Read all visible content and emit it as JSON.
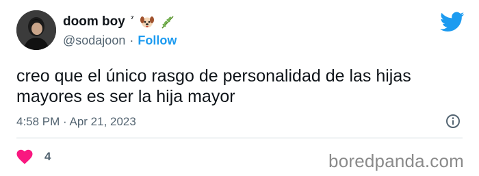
{
  "user": {
    "display_name": "doom boy",
    "superscript": "⁷",
    "emoji_icons": [
      "dog-face-icon",
      "herb-icon"
    ],
    "handle": "@sodajoon",
    "separator": "·",
    "follow_label": "Follow"
  },
  "tweet": {
    "text": "creo que el único rasgo de personalidad de las hijas mayores es ser la hija mayor",
    "timestamp": "4:58 PM · Apr 21, 2023",
    "likes": "4"
  },
  "colors": {
    "accent": "#1d9bf0",
    "heart": "#f91880",
    "text": "#0f1419",
    "secondary": "#536471"
  },
  "watermark": "boredpanda.com"
}
